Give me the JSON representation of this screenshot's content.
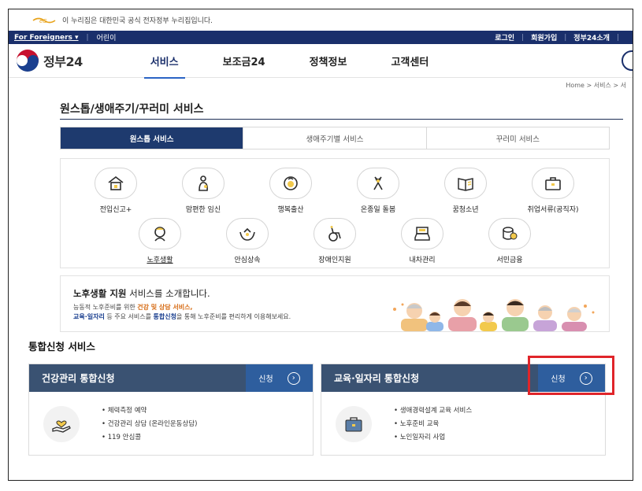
{
  "gov_banner": {
    "text": "이 누리집은 대한민국 공식 전자정부 누리집입니다."
  },
  "topbar": {
    "language": "For Foreigners ▾",
    "kids": "어린이",
    "links": [
      "로그인",
      "회원가입",
      "정부24소개"
    ]
  },
  "header": {
    "brand": "정부24",
    "nav": [
      "서비스",
      "보조금24",
      "정책정보",
      "고객센터"
    ],
    "active_nav": 0
  },
  "breadcrumb": "Home  >  서비스  >  서",
  "page": {
    "title": "원스톱/생애주기/꾸러미 서비스",
    "tabs": [
      "원스톱 서비스",
      "생애주기별 서비스",
      "꾸러미 서비스"
    ],
    "active_tab": 0
  },
  "services_row1": [
    {
      "label": "전입신고+",
      "icon": "house-icon"
    },
    {
      "label": "맘편한 임신",
      "icon": "pregnancy-icon"
    },
    {
      "label": "행복출산",
      "icon": "baby-icon"
    },
    {
      "label": "온종일 돌봄",
      "icon": "ribbon-icon"
    },
    {
      "label": "꿈청소년",
      "icon": "book-icon"
    },
    {
      "label": "취업서류(공직자)",
      "icon": "briefcase-icon"
    }
  ],
  "services_row2": [
    {
      "label": "노후생활",
      "icon": "senior-icon"
    },
    {
      "label": "안심상속",
      "icon": "hands-icon"
    },
    {
      "label": "장애인지원",
      "icon": "wheelchair-icon"
    },
    {
      "label": "내차관리",
      "icon": "car-icon"
    },
    {
      "label": "서민금융",
      "icon": "coins-icon"
    }
  ],
  "intro": {
    "title_bold": "노후생활 지원",
    "title_rest": " 서비스를 소개합니다.",
    "desc_1": "능동적 노후준비를 위한 ",
    "desc_hl_1": "건강 및 상담 서비스,",
    "desc_hl_2": "교육·일자리",
    "desc_2": " 등 주요 서비스를 ",
    "desc_hl_3": "통합신청",
    "desc_3": "을 통해 노후준비를 편리하게 이용해보세요."
  },
  "integrated": {
    "title": "통합신청 서비스",
    "cards": [
      {
        "title": "건강관리 통합신청",
        "apply": "신청",
        "icon": "heart-hand-icon",
        "items": [
          "체력측정 예약",
          "건강관리 상담 (온라인운동상담)",
          "119 안심콜"
        ]
      },
      {
        "title": "교육·일자리 통합신청",
        "apply": "신청",
        "icon": "briefcase-icon",
        "items": [
          "생애경력설계 교육 서비스",
          "노후준비 교육",
          "노인일자리 사업"
        ]
      }
    ]
  },
  "colors": {
    "topbar": "#1a2f6b",
    "tab_active": "#1e3a6e",
    "card_header": "#3a5272",
    "apply_button": "#2e5e9e",
    "highlight": "#e0252a"
  }
}
